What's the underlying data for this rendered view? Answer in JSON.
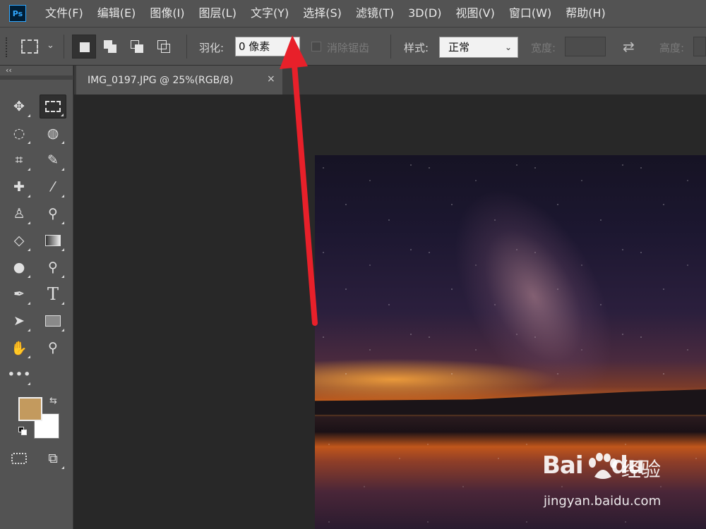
{
  "app": {
    "logo_text": "Ps"
  },
  "menu": [
    "文件(F)",
    "编辑(E)",
    "图像(I)",
    "图层(L)",
    "文字(Y)",
    "选择(S)",
    "滤镜(T)",
    "3D(D)",
    "视图(V)",
    "窗口(W)",
    "帮助(H)"
  ],
  "options": {
    "feather_label": "羽化:",
    "feather_value": "0 像素",
    "antialias_label": "消除锯齿",
    "style_label": "样式:",
    "style_value": "正常",
    "width_label": "宽度:",
    "height_label": "高度:"
  },
  "document": {
    "tab_title": "IMG_0197.JPG @ 25%(RGB/8)",
    "close_glyph": "×"
  },
  "colors": {
    "foreground": "#c39a5e",
    "background": "#ffffff",
    "arrow": "#e8202a"
  },
  "tools": [
    "move-icon",
    "rect-marquee-icon",
    "lasso-icon",
    "quick-select-icon",
    "crop-icon",
    "eyedropper-icon",
    "healing-brush-icon",
    "brush-icon",
    "clone-stamp-icon",
    "history-brush-icon",
    "eraser-icon",
    "gradient-icon",
    "blur-icon",
    "dodge-icon",
    "pen-icon",
    "type-icon",
    "path-select-icon",
    "rectangle-icon",
    "hand-icon",
    "zoom-icon",
    "more-tools-icon",
    "quick-mask-icon",
    "screen-mode-icon"
  ],
  "watermark": {
    "logo": "Bai",
    "logo_du": "du",
    "cn": "经验",
    "url": "jingyan.baidu.com"
  }
}
